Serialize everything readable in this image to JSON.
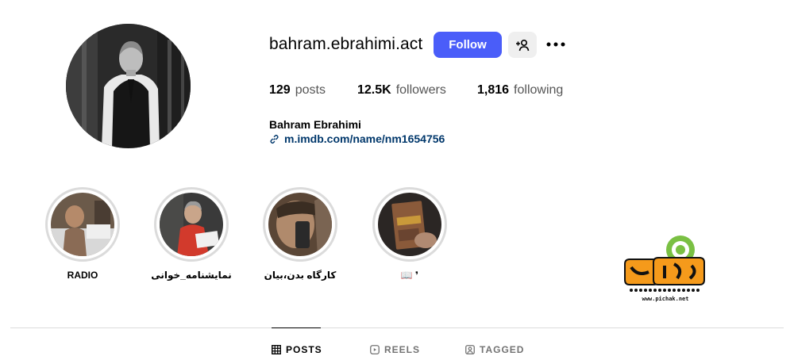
{
  "profile": {
    "username": "bahram.ebrahimi.act",
    "follow_label": "Follow",
    "full_name": "Bahram Ebrahimi",
    "link": "m.imdb.com/name/nm1654756"
  },
  "stats": {
    "posts_count": "129",
    "posts_label": "posts",
    "followers_count": "12.5K",
    "followers_label": "followers",
    "following_count": "1,816",
    "following_label": "following"
  },
  "highlights": [
    {
      "label": "RADIO"
    },
    {
      "label": "نمایشنامه_خوانی"
    },
    {
      "label": "کارگاه بدن،بیان"
    },
    {
      "label": "📖 ❜"
    }
  ],
  "tabs": {
    "posts": "POSTS",
    "reels": "REELS",
    "tagged": "TAGGED"
  },
  "watermark": {
    "text": "www.pichak.net"
  },
  "colors": {
    "follow_button": "#4a5df9",
    "link": "#00376b",
    "muted_text": "#737373",
    "divider": "#dbdbdb"
  },
  "icons": {
    "suggest": "person-plus-icon",
    "more": "more-dots-icon",
    "link": "link-icon",
    "posts_tab": "grid-icon",
    "reels_tab": "reels-icon",
    "tagged_tab": "tagged-icon"
  }
}
